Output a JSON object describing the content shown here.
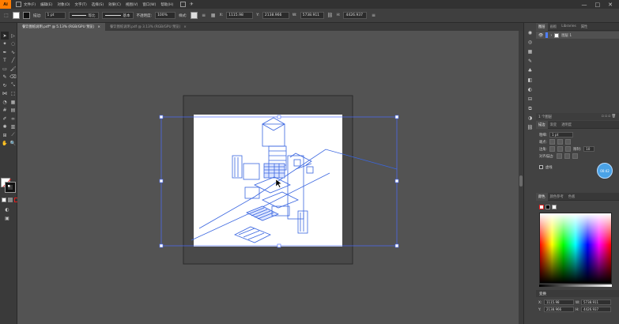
{
  "app": {
    "logo": "Ai"
  },
  "menu": {
    "items": [
      "文件(F)",
      "编辑(E)",
      "对象(O)",
      "文字(T)",
      "选择(S)",
      "效果(C)",
      "视图(V)",
      "窗口(W)",
      "帮助(H)"
    ],
    "window_controls": [
      "—",
      "□",
      "✕"
    ]
  },
  "control_bar": {
    "stroke_label": "描边:",
    "stroke_weight": "1 pt",
    "profile_label": "等比",
    "brush_label": "基本",
    "opacity_label": "不透明度:",
    "opacity_value": "100%",
    "style_label": "样式:",
    "x_value": "1115.98",
    "y_value": "2138.966",
    "w_value": "5738.911",
    "h_value": "4426.937"
  },
  "tabs": [
    {
      "label": "餐饮图纸说明.pdf* @ 5.13% (RGB/GPU 预览)",
      "close": "×"
    },
    {
      "label": "餐饮图纸说明.pdf @ 3.13% (RGB/GPU 预览)",
      "close": "×"
    }
  ],
  "layers_panel": {
    "tabs": [
      "图层",
      "画板",
      "Libraries",
      "属性"
    ],
    "active_tab": "图层",
    "layer_name": "图层 1",
    "footer_text": "1 个图层"
  },
  "appearance_panel": {
    "tabs": [
      "描边",
      "渐变",
      "透明度"
    ],
    "weight_label": "粗细:",
    "weight_value": "1 pt",
    "cap_label": "端点:",
    "corner_label": "边角:",
    "limit_label": "限制:",
    "limit_value": "10",
    "align_label": "对齐描边:",
    "dashed_label": "虚线"
  },
  "swatches_panel": {
    "tabs": [
      "颜色",
      "颜色参考",
      "色板"
    ]
  },
  "transform_panel": {
    "title": "变换",
    "x": "1115.98",
    "y": "2138.966",
    "w": "5738.911",
    "h": "4426.937"
  },
  "bubble_label": "00:42",
  "colors": {
    "line_art": "#3a66e0",
    "selection": "#4a6cff",
    "accent": "#ff7c00"
  }
}
